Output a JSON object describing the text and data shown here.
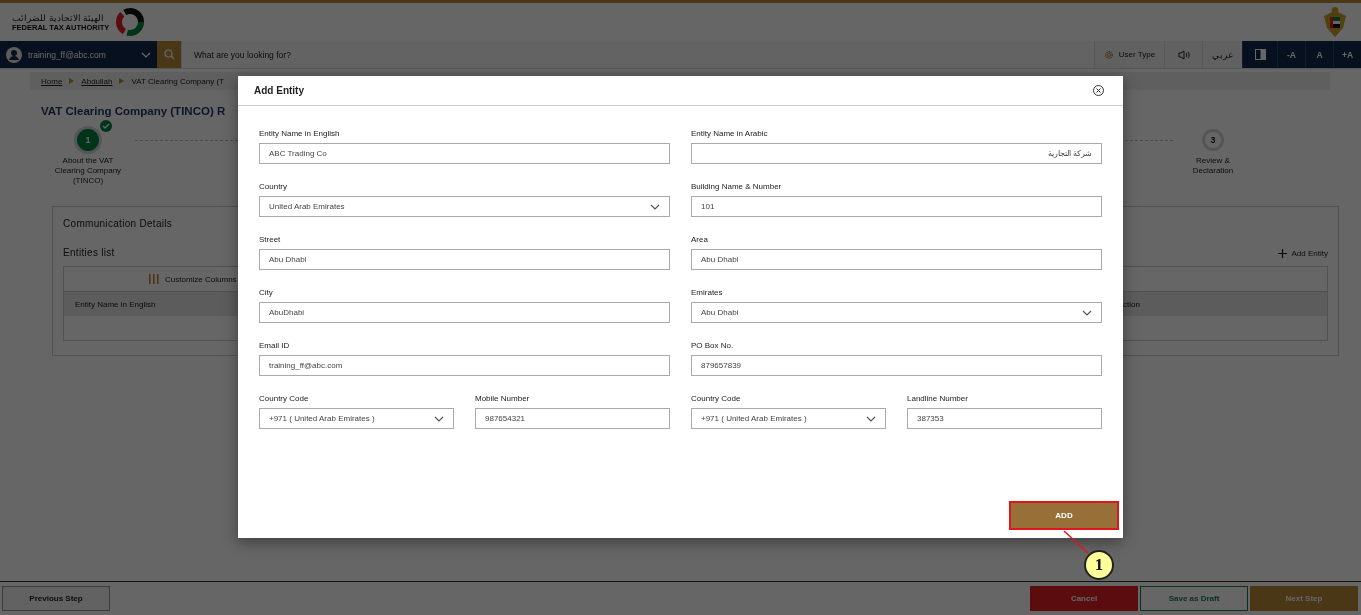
{
  "header": {
    "logo_arabic": "الهيئة الاتحادية للضرائب",
    "logo_english": "FEDERAL TAX AUTHORITY"
  },
  "nav": {
    "user": "training_ff@abc.com",
    "search": {
      "placeholder": "What are you looking for?"
    },
    "user_type": "User Type",
    "language": "عربي",
    "font_buttons": [
      "-A",
      "A",
      "+A"
    ]
  },
  "breadcrumb": [
    {
      "label": "Home",
      "kind": "link"
    },
    {
      "label": "Abdullah",
      "kind": "link"
    },
    {
      "label": "VAT Clearing Company (T",
      "kind": "current"
    }
  ],
  "page_title": "VAT Clearing Company (TINCO) R",
  "steps": [
    {
      "number": "1",
      "label": "About the VAT Clearing Company (TINCO)",
      "completed": true
    },
    {
      "number": "3",
      "label": "Review & Declaration",
      "completed": false
    }
  ],
  "card": {
    "title": "Communication Details",
    "subtitle": "Entities list",
    "add_link": "Add Entity",
    "customize": "Customize Columns",
    "columns": [
      "Entity Name in English",
      "ction"
    ]
  },
  "modal": {
    "title": "Add Entity",
    "rows": [
      {
        "fields": [
          {
            "label": "Entity Name in English",
            "value": "ABC Trading Co",
            "kind": "text"
          },
          {
            "label": "Entity Name in Arabic",
            "value": "شركة التجارية",
            "kind": "text"
          }
        ]
      },
      {
        "fields": [
          {
            "label": "Country",
            "value": "United Arab Emirates",
            "kind": "select"
          },
          {
            "label": "Building Name & Number",
            "value": "101",
            "kind": "text"
          }
        ]
      },
      {
        "fields": [
          {
            "label": "Street",
            "value": "Abu Dhabi",
            "kind": "text"
          },
          {
            "label": "Area",
            "value": "Abu Dhabi",
            "kind": "text"
          }
        ]
      },
      {
        "fields": [
          {
            "label": "City",
            "value": "AbuDhabi",
            "kind": "text"
          },
          {
            "label": "Emirates",
            "value": "Abu Dhabi",
            "kind": "select"
          }
        ]
      },
      {
        "fields": [
          {
            "label": "Email ID",
            "value": "training_ff@abc.com",
            "kind": "text"
          },
          {
            "label": "PO Box No.",
            "value": "879657839",
            "kind": "text"
          }
        ]
      },
      {
        "fields": [
          {
            "label": "Country Code",
            "value": "+971 ( United Arab Emirates )",
            "kind": "select"
          },
          {
            "label": "Mobile Number",
            "value": "987654321",
            "kind": "text"
          },
          {
            "label": "Country Code",
            "value": "+971 ( United Arab Emirates )",
            "kind": "select"
          },
          {
            "label": "Landline Number",
            "value": "387353",
            "kind": "text"
          }
        ]
      }
    ],
    "add_button": "ADD"
  },
  "annotation": {
    "number": "1"
  },
  "footer": {
    "previous": "Previous Step",
    "cancel": "Cancel",
    "save": "Save as Draft",
    "next": "Next Step"
  }
}
